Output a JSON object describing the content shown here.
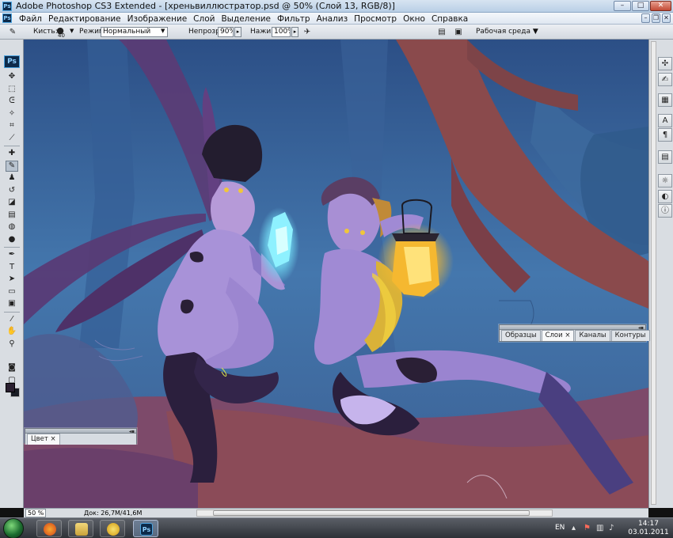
{
  "window": {
    "title": "Adobe Photoshop CS3 Extended - [хреньвиллюстратор.psd @ 50% (Слой 13, RGB/8)]",
    "app_icon": "Ps",
    "controls": {
      "minimize": "–",
      "maximize": "□",
      "close": "✕"
    },
    "doc_controls": {
      "minimize": "–",
      "restore": "❐",
      "close": "✕"
    }
  },
  "menu": {
    "app_icon": "Ps",
    "items": [
      "Файл",
      "Редактирование",
      "Изображение",
      "Слой",
      "Выделение",
      "Фильтр",
      "Анализ",
      "Просмотр",
      "Окно",
      "Справка"
    ]
  },
  "options": {
    "brush_label": "Кисть:",
    "brush_size": "40",
    "mode_label": "Режим:",
    "mode_value": "Нормальный",
    "opacity_label": "Непрозр.:",
    "opacity_value": "90%",
    "flow_label": "Нажим:",
    "flow_value": "100%",
    "workspace": "Рабочая среда ▼"
  },
  "toolbox": {
    "header": "Ps",
    "tools": [
      {
        "name": "move-tool",
        "glyph": "✥"
      },
      {
        "name": "marquee-tool",
        "glyph": "⬚"
      },
      {
        "name": "lasso-tool",
        "glyph": "ᕮ"
      },
      {
        "name": "magic-wand-tool",
        "glyph": "✧"
      },
      {
        "name": "crop-tool",
        "glyph": "⌗"
      },
      {
        "name": "slice-tool",
        "glyph": "⟋"
      },
      {
        "name": "healing-brush-tool",
        "glyph": "✚"
      },
      {
        "name": "brush-tool",
        "glyph": "✎"
      },
      {
        "name": "clone-stamp-tool",
        "glyph": "♟"
      },
      {
        "name": "history-brush-tool",
        "glyph": "↺"
      },
      {
        "name": "eraser-tool",
        "glyph": "◪"
      },
      {
        "name": "gradient-tool",
        "glyph": "▤"
      },
      {
        "name": "blur-tool",
        "glyph": "◍"
      },
      {
        "name": "dodge-tool",
        "glyph": "●"
      },
      {
        "name": "pen-tool",
        "glyph": "✒"
      },
      {
        "name": "type-tool",
        "glyph": "T"
      },
      {
        "name": "path-selection-tool",
        "glyph": "➤"
      },
      {
        "name": "shape-tool",
        "glyph": "▭"
      },
      {
        "name": "notes-tool",
        "glyph": "▣"
      },
      {
        "name": "eyedropper-tool",
        "glyph": "⁄"
      },
      {
        "name": "hand-tool",
        "glyph": "✋"
      },
      {
        "name": "zoom-tool",
        "glyph": "⚲"
      }
    ],
    "quickmask": "◙",
    "screenmode": "▢"
  },
  "right_panel_buttons": [
    {
      "name": "navigator-icon",
      "glyph": "✣"
    },
    {
      "name": "info-icon",
      "glyph": "✍"
    },
    {
      "name": "history-icon",
      "glyph": "▦"
    },
    {
      "name": "character-icon",
      "glyph": "A"
    },
    {
      "name": "paragraph-icon",
      "glyph": "¶"
    },
    {
      "name": "layer-comps-icon",
      "glyph": "▤"
    },
    {
      "name": "brushes-icon",
      "glyph": "☼"
    },
    {
      "name": "tool-presets-icon",
      "glyph": "◐"
    },
    {
      "name": "info-circle-icon",
      "glyph": "ⓘ"
    }
  ],
  "panels": {
    "layers": {
      "tabs": [
        "Образцы",
        "Слои ×",
        "Каналы",
        "Контуры"
      ],
      "active": 1
    },
    "color": {
      "tabs": [
        "Цвет ×"
      ]
    }
  },
  "status": {
    "zoom": "50 %",
    "doc": "Док: 26,7M/41,6M"
  },
  "taskbar": {
    "lang": "EN",
    "time": "14:17",
    "date": "03.01.2011",
    "apps": [
      {
        "name": "firefox-app",
        "label": ""
      },
      {
        "name": "explorer-app",
        "label": ""
      },
      {
        "name": "aimp-app",
        "label": ""
      },
      {
        "name": "photoshop-app",
        "label": "Ps"
      }
    ]
  },
  "colors": {
    "canvas_sky": "#3f6da2",
    "tree_brown": "#8a4a4c",
    "skin": "#9b86d0",
    "lantern": "#f5b830"
  }
}
